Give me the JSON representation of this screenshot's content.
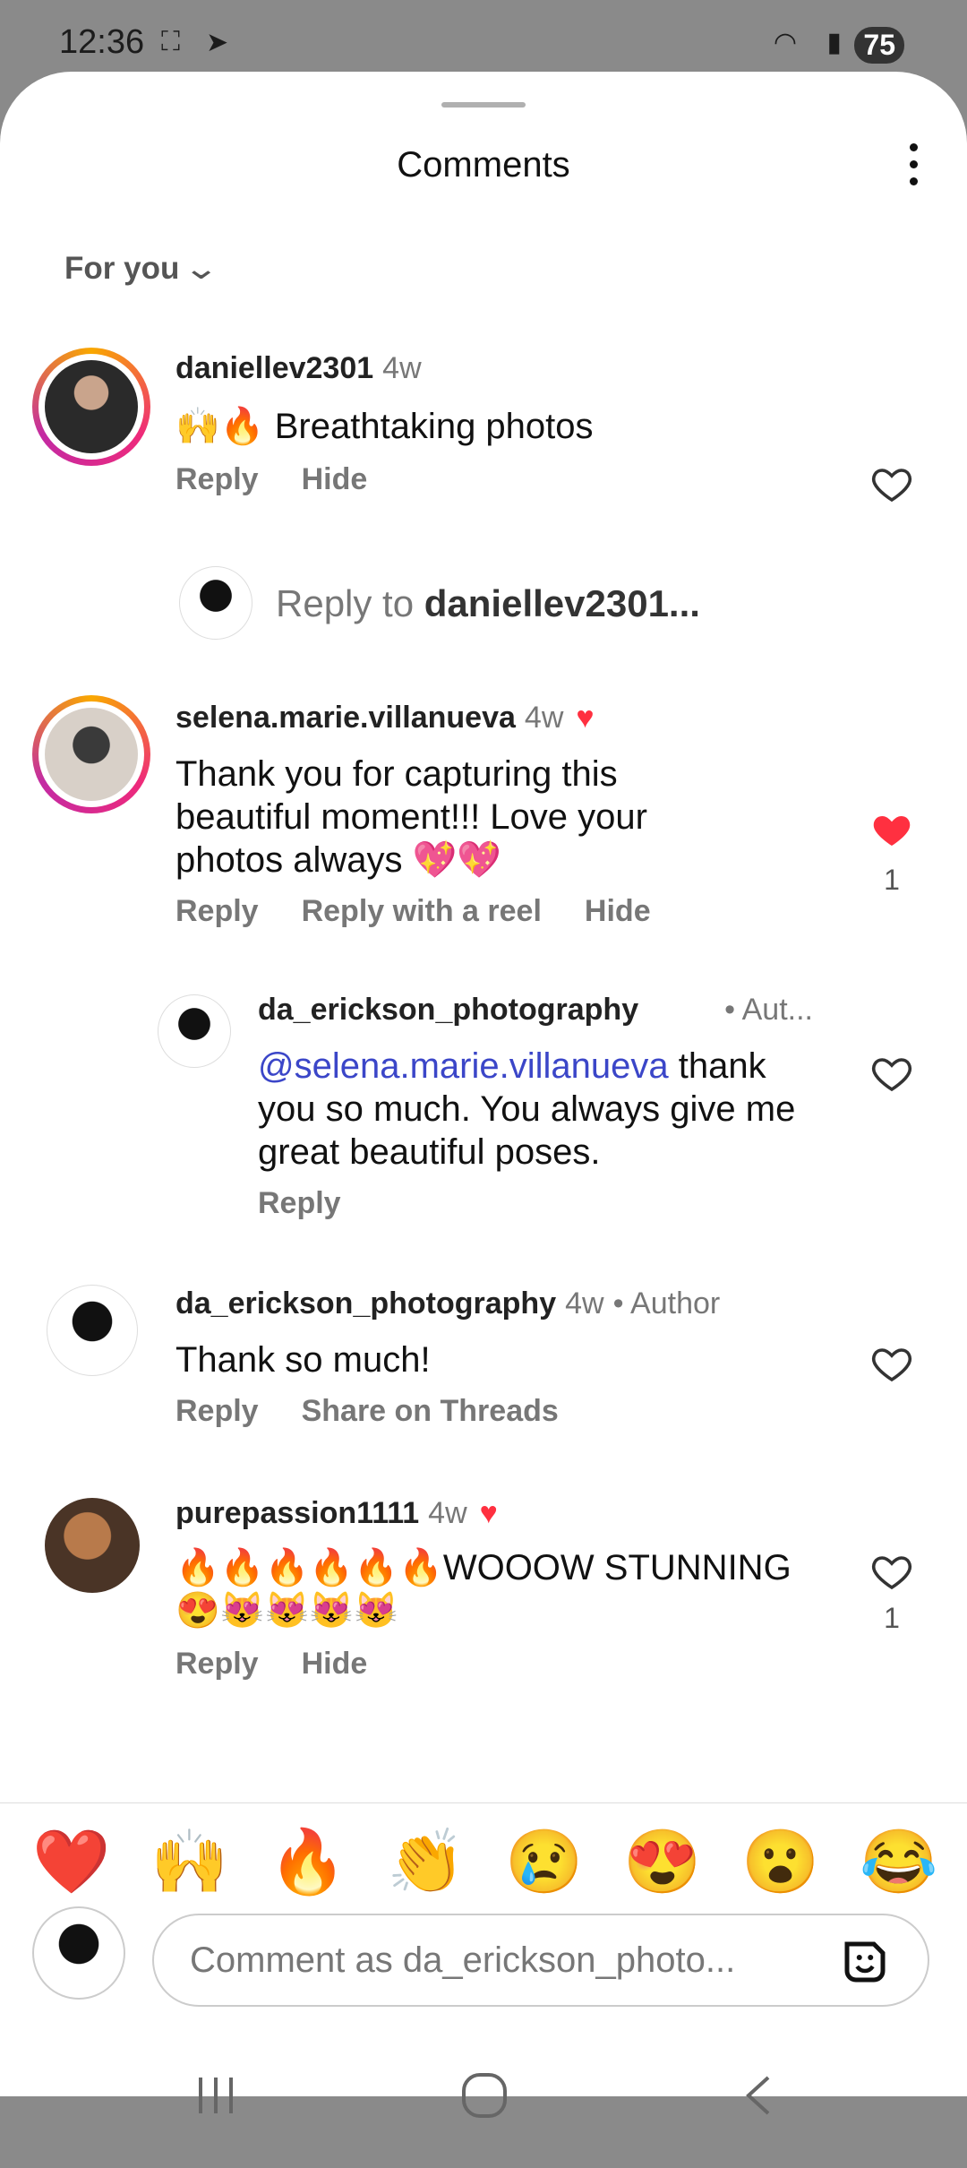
{
  "status": {
    "time": "12:36",
    "battery": "75"
  },
  "header": {
    "title": "Comments"
  },
  "filter": {
    "label": "For you"
  },
  "comments": [
    {
      "user": "daniellev2301",
      "time": "4w",
      "text": "🙌🔥 Breathtaking photos",
      "actions": [
        "Reply",
        "Hide"
      ],
      "liked": false,
      "likes": ""
    },
    {
      "user": "selena.marie.villanueva",
      "time": "4w",
      "text": "Thank you for capturing this beautiful moment!!! Love your photos always 💖💖",
      "actions": [
        "Reply",
        "Reply with a reel",
        "Hide"
      ],
      "liked": true,
      "likes": "1"
    },
    {
      "user": "da_erickson_photography",
      "time": "",
      "author": "• Aut...",
      "mention": "@selena.marie.villanueva",
      "text": " thank you so much. You always give me great beautiful  poses.",
      "actions": [
        "Reply"
      ],
      "liked": false,
      "likes": ""
    },
    {
      "user": "da_erickson_photography",
      "time": "4w",
      "author": "• Author",
      "text": "Thank so much!",
      "actions": [
        "Reply",
        "Share on Threads"
      ],
      "liked": false,
      "likes": ""
    },
    {
      "user": "purepassion1111",
      "time": "4w",
      "text": "🔥🔥🔥🔥🔥🔥WOOOW STUNNING 😍😻😻😻😻",
      "actions": [
        "Reply",
        "Hide"
      ],
      "liked": false,
      "likes": "1"
    }
  ],
  "reply_prompt": {
    "prefix": "Reply to ",
    "user": "daniellev2301..."
  },
  "emoji_bar": [
    "❤️",
    "🙌",
    "🔥",
    "👏",
    "😢",
    "😍",
    "😮",
    "😂"
  ],
  "composer": {
    "placeholder": "Comment as da_erickson_photo..."
  },
  "colors": {
    "liked_heart": "#ff3040",
    "mention": "#3b46c8"
  }
}
